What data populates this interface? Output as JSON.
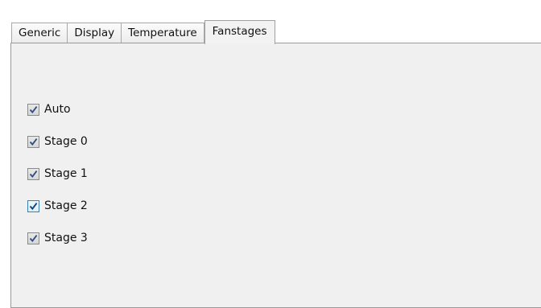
{
  "tabs": [
    {
      "label": "Generic",
      "active": false
    },
    {
      "label": "Display",
      "active": false
    },
    {
      "label": "Temperature",
      "active": false
    },
    {
      "label": "Fanstages",
      "active": true
    }
  ],
  "checkboxes": [
    {
      "label": "Auto",
      "checked": true
    },
    {
      "label": "Stage 0",
      "checked": true
    },
    {
      "label": "Stage 1",
      "checked": true
    },
    {
      "label": "Stage 2",
      "checked": true,
      "focused": true
    },
    {
      "label": "Stage 3",
      "checked": true
    }
  ],
  "colors": {
    "panel_bg": "#f0f0f0",
    "check_mark": "#2b4c7e",
    "focus_border": "#3c7fb1"
  }
}
